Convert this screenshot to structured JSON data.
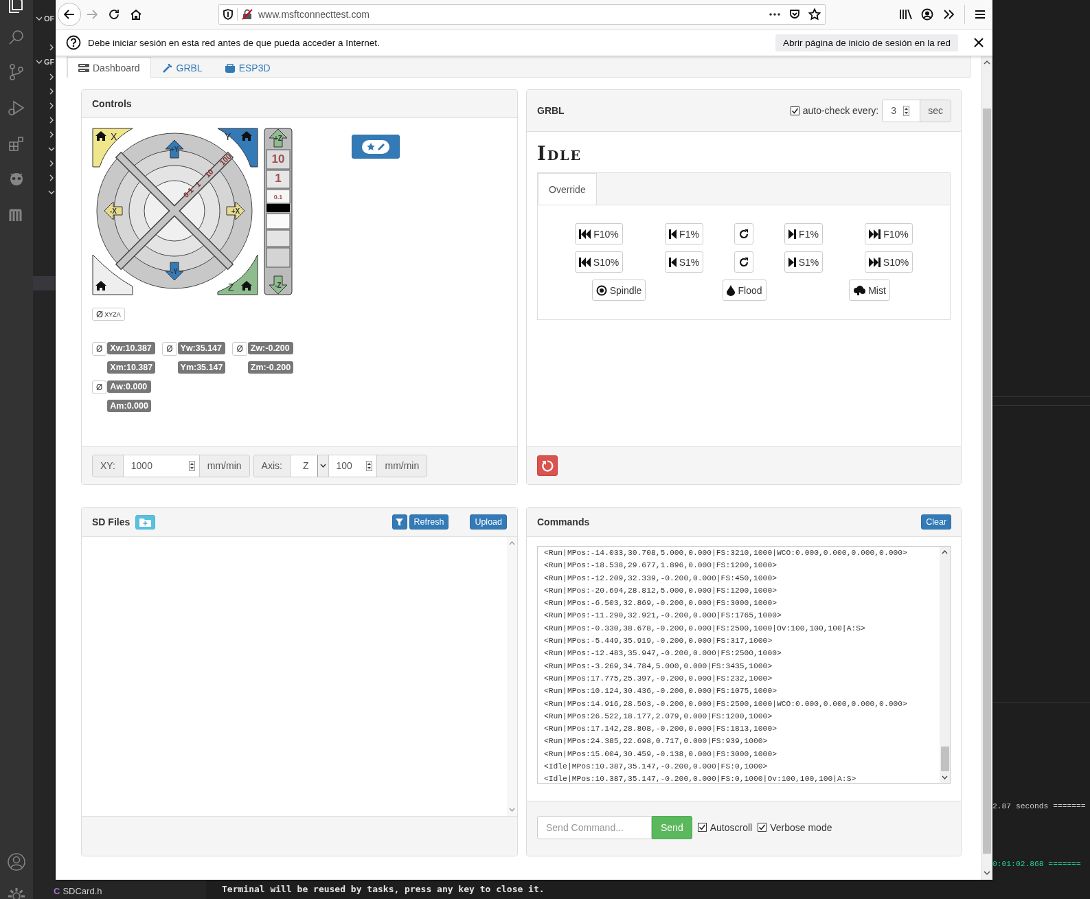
{
  "vscode": {
    "explorer_labels": [
      "OF",
      "GF"
    ],
    "files": [
      {
        "name": "SDCard.h",
        "kind": "c",
        "icon": "C"
      }
    ],
    "terminal_lines": [
      {
        "text": "2.87 seconds =======",
        "kind": "plain"
      },
      {
        "text": "0:01:02.868 =======",
        "kind": "success"
      }
    ],
    "terminal_message": "Terminal will be reused by tasks, press any key to close it."
  },
  "browser": {
    "url": "www.msftconnecttest.com",
    "notification": "Debe iniciar sesión en esta red antes de que pueda acceder a Internet.",
    "notification_button": "Abrir página de inicio de sesión en la red"
  },
  "tabs": [
    {
      "label": "Dashboard",
      "kind": "dashboard",
      "selected": true
    },
    {
      "label": "GRBL",
      "kind": "wrench",
      "selected": false
    },
    {
      "label": "ESP3D",
      "kind": "esp",
      "selected": false
    }
  ],
  "controls": {
    "title": "Controls",
    "home_corners": [
      {
        "axis": "X",
        "kind": "x"
      },
      {
        "axis": "Y",
        "kind": "y"
      },
      {
        "axis": "Z",
        "kind": "z"
      }
    ],
    "jog_arrows": [
      {
        "label": "+Y",
        "kind": "up"
      },
      {
        "label": "-Y",
        "kind": "down"
      },
      {
        "label": "-X",
        "kind": "left"
      },
      {
        "label": "+X",
        "kind": "right"
      },
      {
        "label": "+Z",
        "kind": "zup"
      },
      {
        "label": "-Z",
        "kind": "zdown"
      }
    ],
    "xy_steps": [
      "100",
      "10",
      "1",
      "0.1"
    ],
    "z_steps": [
      "10",
      "1",
      "0.1"
    ],
    "zero_all": {
      "symbol": "Ø",
      "axes": "XYZA"
    },
    "positions": [
      {
        "zero": "Ø",
        "work": "Xw:10.387",
        "machine": "Xm:10.387"
      },
      {
        "zero": "Ø",
        "work": "Yw:35.147",
        "machine": "Ym:35.147"
      },
      {
        "zero": "Ø",
        "work": "Zw:-0.200",
        "machine": "Zm:-0.200"
      },
      {
        "zero": "Ø",
        "work": "Aw:0.000",
        "machine": "Am:0.000"
      }
    ],
    "feed": {
      "xy_label": "XY:",
      "xy_value": "1000",
      "xy_unit": "mm/min",
      "axis_label": "Axis:",
      "axis_value": "Z",
      "axis_feed": "100",
      "axis_unit": "mm/min"
    }
  },
  "grbl": {
    "title": "GRBL",
    "autocheck_label": "auto-check every:",
    "autocheck_checked": true,
    "autocheck_value": "3",
    "autocheck_unit": "sec",
    "state": "Idle",
    "override_tabs": [
      {
        "label": "Override",
        "selected": true
      }
    ],
    "override_rows": [
      {
        "buttons": [
          {
            "kind": "fast-back",
            "label": "F10%"
          },
          {
            "kind": "back",
            "label": "F1%"
          },
          {
            "kind": "reset"
          },
          {
            "kind": "forward",
            "label": "F1%"
          },
          {
            "kind": "fast-forward",
            "label": "F10%"
          }
        ]
      },
      {
        "buttons": [
          {
            "kind": "fast-back",
            "label": "S10%"
          },
          {
            "kind": "back",
            "label": "S1%"
          },
          {
            "kind": "reset"
          },
          {
            "kind": "forward",
            "label": "S1%"
          },
          {
            "kind": "fast-forward",
            "label": "S10%"
          }
        ]
      }
    ],
    "coolant_buttons": [
      {
        "kind": "spindle",
        "label": "Spindle"
      },
      {
        "kind": "flood",
        "label": "Flood"
      },
      {
        "kind": "mist",
        "label": "Mist"
      }
    ]
  },
  "sd_files": {
    "title": "SD Files",
    "refresh": "Refresh",
    "upload": "Upload"
  },
  "commands": {
    "title": "Commands",
    "clear": "Clear",
    "lines": [
      "<Run|MPos:-14.033,30.708,5.000,0.000|FS:3210,1000|WCO:0.000,0.000,0.000,0.000>",
      "<Run|MPos:-18.538,29.677,1.896,0.000|FS:1200,1000>",
      "<Run|MPos:-12.209,32.339,-0.200,0.000|FS:450,1000>",
      "<Run|MPos:-20.694,28.812,5.000,0.000|FS:1200,1000>",
      "<Run|MPos:-6.503,32.869,-0.200,0.000|FS:3000,1000>",
      "<Run|MPos:-11.290,32.921,-0.200,0.000|FS:1765,1000>",
      "<Run|MPos:-0.330,38.678,-0.200,0.000|FS:2500,1000|Ov:100,100,100|A:S>",
      "<Run|MPos:-5.449,35.919,-0.200,0.000|FS:317,1000>",
      "<Run|MPos:-12.483,35.947,-0.200,0.000|FS:2500,1000>",
      "<Run|MPos:-3.269,34.784,5.000,0.000|FS:3435,1000>",
      "<Run|MPos:17.775,25.397,-0.200,0.000|FS:232,1000>",
      "<Run|MPos:10.124,30.436,-0.200,0.000|FS:1075,1000>",
      "<Run|MPos:14.916,28.503,-0.200,0.000|FS:2500,1000|WCO:0.000,0.000,0.000,0.000>",
      "<Run|MPos:26.522,18.177,2.079,0.000|FS:1200,1000>",
      "<Run|MPos:17.142,28.808,-0.200,0.000|FS:1813,1000>",
      "<Run|MPos:24.385,22.698,0.717,0.000|FS:939,1000>",
      "<Run|MPos:15.004,30.459,-0.138,0.000|FS:3000,1000>",
      "<Idle|MPos:10.387,35.147,-0.200,0.000|FS:0,1000>",
      "<Idle|MPos:10.387,35.147,-0.200,0.000|FS:0,1000|Ov:100,100,100|A:S>"
    ],
    "placeholder": "Send Command...",
    "send": "Send",
    "options": [
      {
        "label": "Autoscroll",
        "checked": true
      },
      {
        "label": "Verbose mode",
        "checked": true
      }
    ]
  }
}
